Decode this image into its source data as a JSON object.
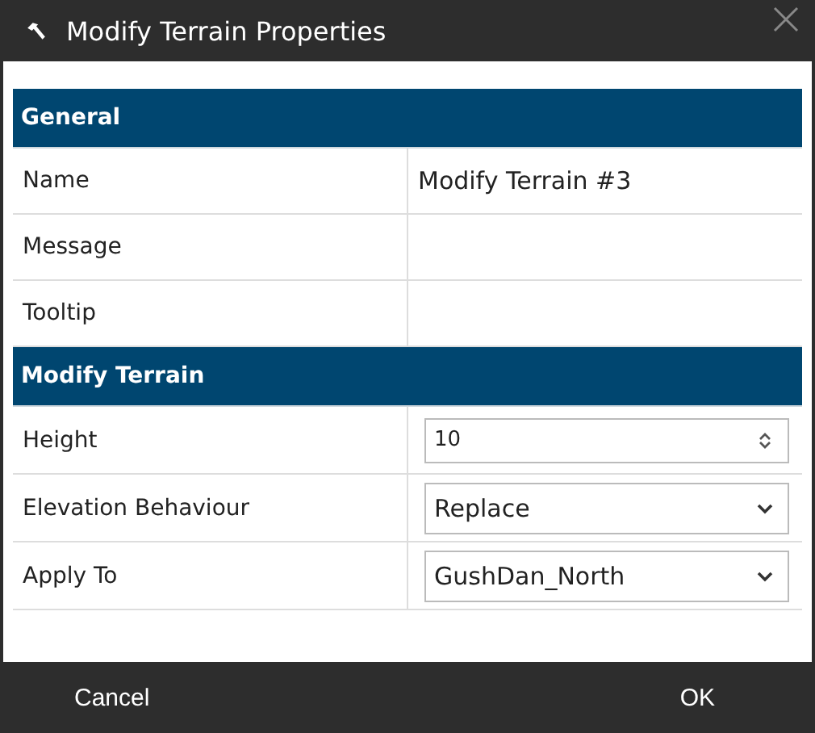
{
  "window": {
    "title": "Modify Terrain Properties"
  },
  "sections": [
    {
      "title": "General",
      "rows": [
        {
          "label": "Name",
          "kind": "text",
          "value": "Modify Terrain #3"
        },
        {
          "label": "Message",
          "kind": "text"
        },
        {
          "label": "Tooltip",
          "kind": "text"
        }
      ]
    },
    {
      "title": "Modify Terrain",
      "rows": [
        {
          "label": "Height",
          "kind": "number",
          "value": "10"
        },
        {
          "label": "Elevation Behaviour",
          "kind": "select",
          "value": "Replace"
        },
        {
          "label": "Apply To",
          "kind": "select",
          "value": "GushDan_North"
        }
      ]
    }
  ],
  "buttons": [
    "Cancel",
    "OK"
  ]
}
